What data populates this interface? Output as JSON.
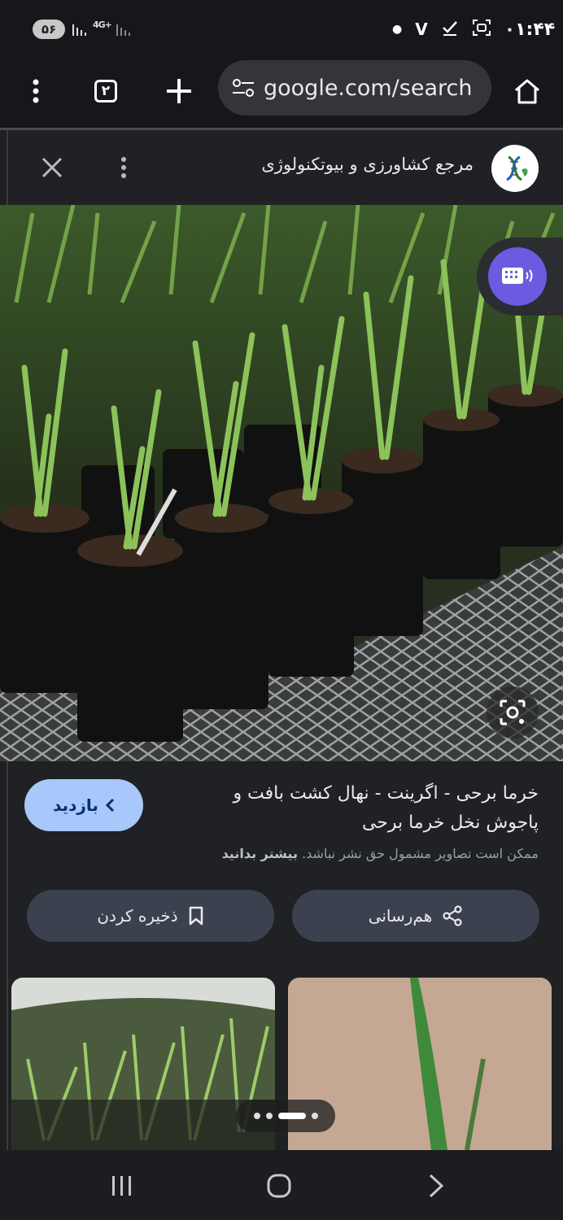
{
  "status_bar": {
    "battery": "۵۶",
    "network": "4G+",
    "time": "۰۱:۴۴",
    "icons": [
      "signal-icon",
      "network-4g-icon",
      "v-notification-icon",
      "check-notification-icon",
      "screenshot-icon",
      "dot-icon"
    ]
  },
  "browser": {
    "url": "google.com/search",
    "tab_count": "۲"
  },
  "source": {
    "name": "مرجع کشاورزی و بیوتکنولوژی"
  },
  "result": {
    "title": "خرما برحی - اگرینت - نهال کشت بافت و پاجوش نخل خرما برحی",
    "copyright_text": "ممکن است تصاویر مشمول حق نشر نباشد.",
    "copyright_link": "بیشتر بدانید",
    "visit_label": "بازدید",
    "save_label": "ذخیره کردن",
    "share_label": "هم‌رسانی"
  },
  "related": {
    "pager_count": 4,
    "active_index": 2
  },
  "colors": {
    "accent": "#a8c7fa",
    "keyboard_fab": "#6a5be0",
    "background": "#1f1f1f"
  }
}
